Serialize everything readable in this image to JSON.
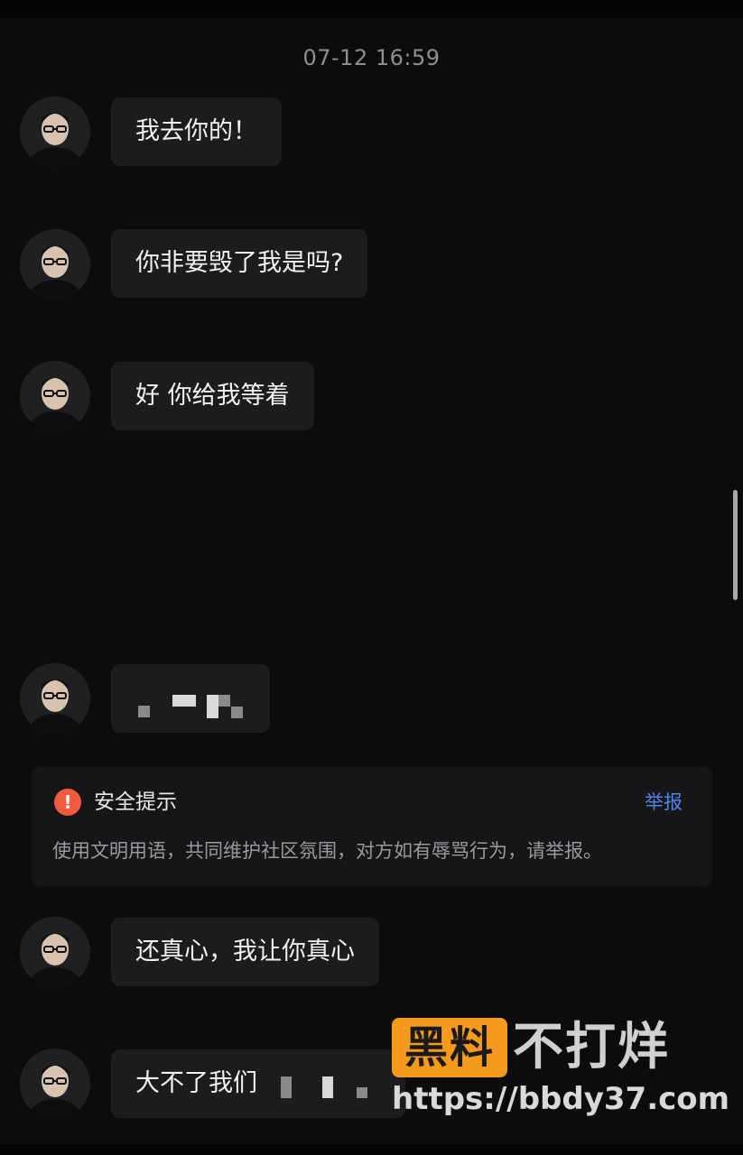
{
  "chat": {
    "timestamp": "07-12 16:59",
    "messages": [
      {
        "text": "我去你的！"
      },
      {
        "text": "你非要毁了我是吗?"
      },
      {
        "text": "好 你给我等着"
      },
      {
        "text": ""
      },
      {
        "text": "还真心，我让你真心"
      },
      {
        "text": "大不了我们"
      }
    ]
  },
  "safety_notice": {
    "icon": "warning-icon",
    "title": "安全提示",
    "report_label": "举报",
    "body": "使用文明用语，共同维护社区氛围，对方如有辱骂行为，请举报。"
  },
  "watermark": {
    "badge": "黑料",
    "text": "不打烊",
    "url": "https://bbdy37.com"
  },
  "colors": {
    "background": "#0c0c0d",
    "bubble": "#1c1c1e",
    "link": "#4e86e8",
    "warning": "#f05a3f",
    "watermark_badge": "#f59a1c"
  }
}
